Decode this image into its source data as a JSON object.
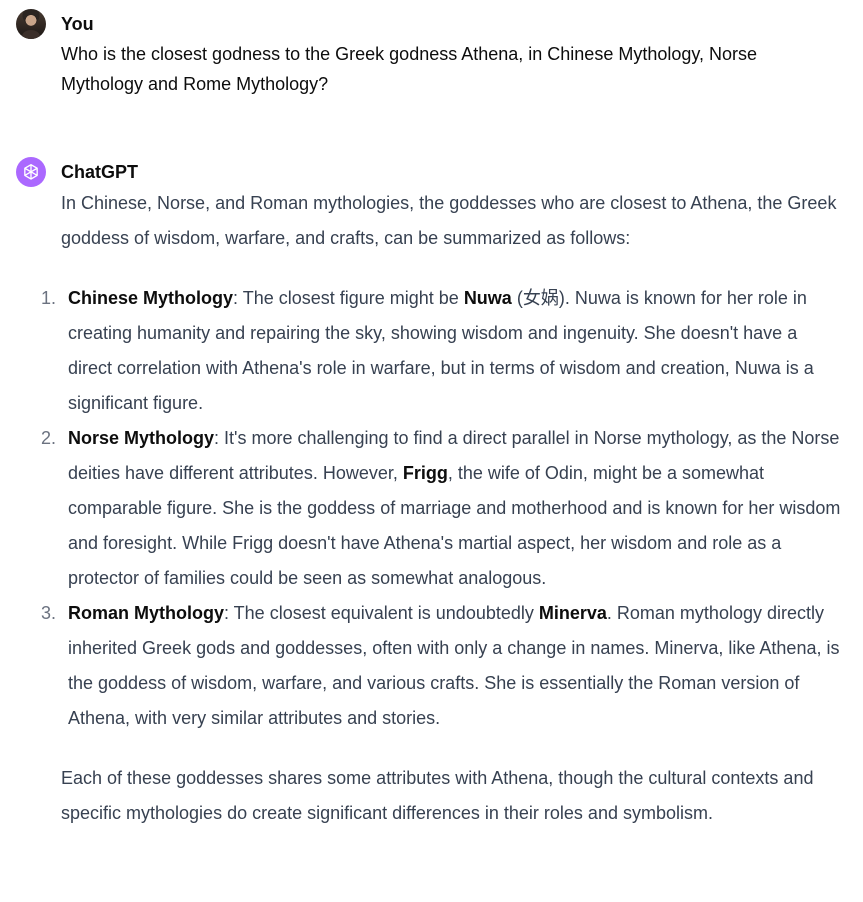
{
  "user": {
    "author": "You",
    "message": "Who is the closest godness to the Greek godness Athena, in Chinese Mythology, Norse Mythology and Rome Mythology?"
  },
  "assistant": {
    "author": "ChatGPT",
    "intro": "In Chinese, Norse, and Roman mythologies, the goddesses who are closest to Athena, the Greek goddess of wisdom, warfare, and crafts, can be summarized as follows:",
    "items": [
      {
        "number": "1.",
        "heading": "Chinese Mythology",
        "text_a": ": The closest figure might be ",
        "name": "Nuwa",
        "text_b": " (女娲). Nuwa is known for her role in creating humanity and repairing the sky, showing wisdom and ingenuity. She doesn't have a direct correlation with Athena's role in warfare, but in terms of wisdom and creation, Nuwa is a significant figure."
      },
      {
        "number": "2.",
        "heading": "Norse Mythology",
        "text_a": ": It's more challenging to find a direct parallel in Norse mythology, as the Norse deities have different attributes. However, ",
        "name": "Frigg",
        "text_b": ", the wife of Odin, might be a somewhat comparable figure. She is the goddess of marriage and motherhood and is known for her wisdom and foresight. While Frigg doesn't have Athena's martial aspect, her wisdom and role as a protector of families could be seen as somewhat analogous."
      },
      {
        "number": "3.",
        "heading": "Roman Mythology",
        "text_a": ": The closest equivalent is undoubtedly ",
        "name": "Minerva",
        "text_b": ". Roman mythology directly inherited Greek gods and goddesses, often with only a change in names. Minerva, like Athena, is the goddess of wisdom, warfare, and various crafts. She is essentially the Roman version of Athena, with very similar attributes and stories."
      }
    ],
    "conclusion": "Each of these goddesses shares some attributes with Athena, though the cultural contexts and specific mythologies do create significant differences in their roles and symbolism."
  },
  "icons": {
    "user_avatar": "user-avatar-photo",
    "assistant_avatar": "openai-logo-icon"
  },
  "colors": {
    "assistant_avatar_bg": "#ab68ff",
    "text": "#0d0d0d",
    "assistant_text": "#374151",
    "list_number": "#6b7280"
  }
}
